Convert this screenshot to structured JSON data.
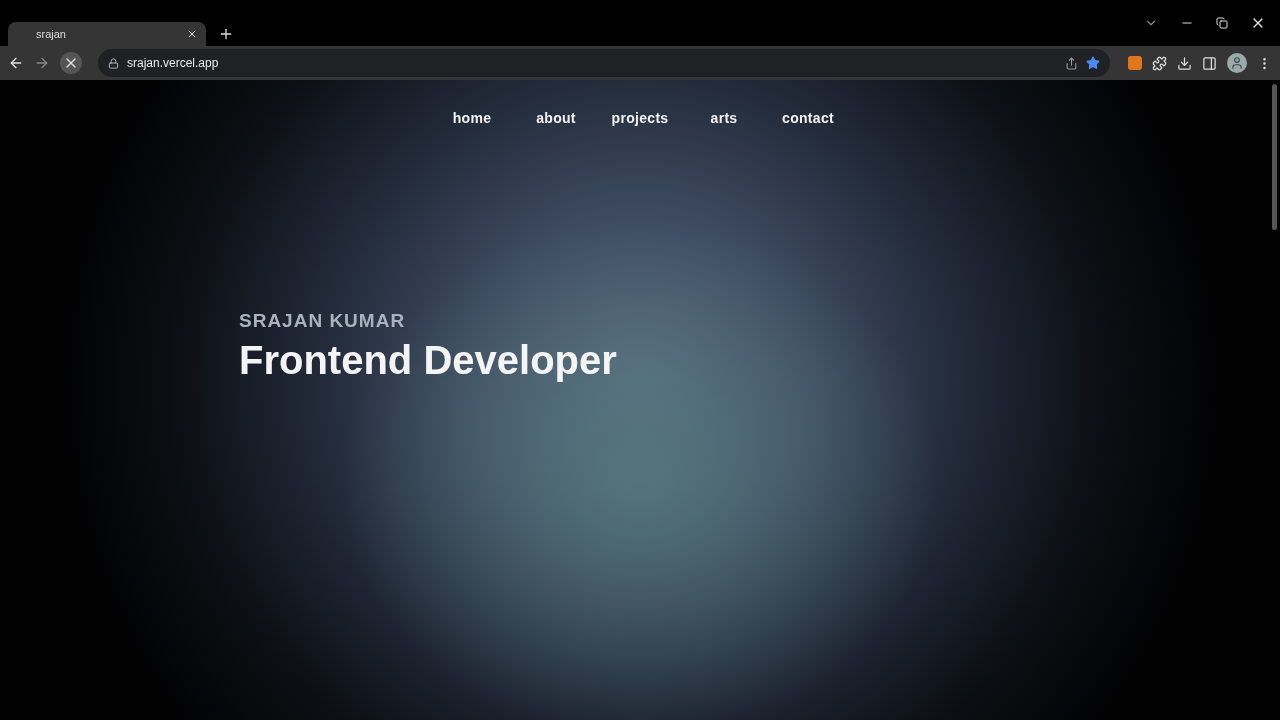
{
  "browser": {
    "tab_title": "srajan",
    "url": "srajan.vercel.app",
    "bookmarked": true
  },
  "nav": [
    "home",
    "about",
    "projects",
    "arts",
    "contact"
  ],
  "hero": {
    "name": "SRAJAN KUMAR",
    "title": "Frontend Developer"
  }
}
